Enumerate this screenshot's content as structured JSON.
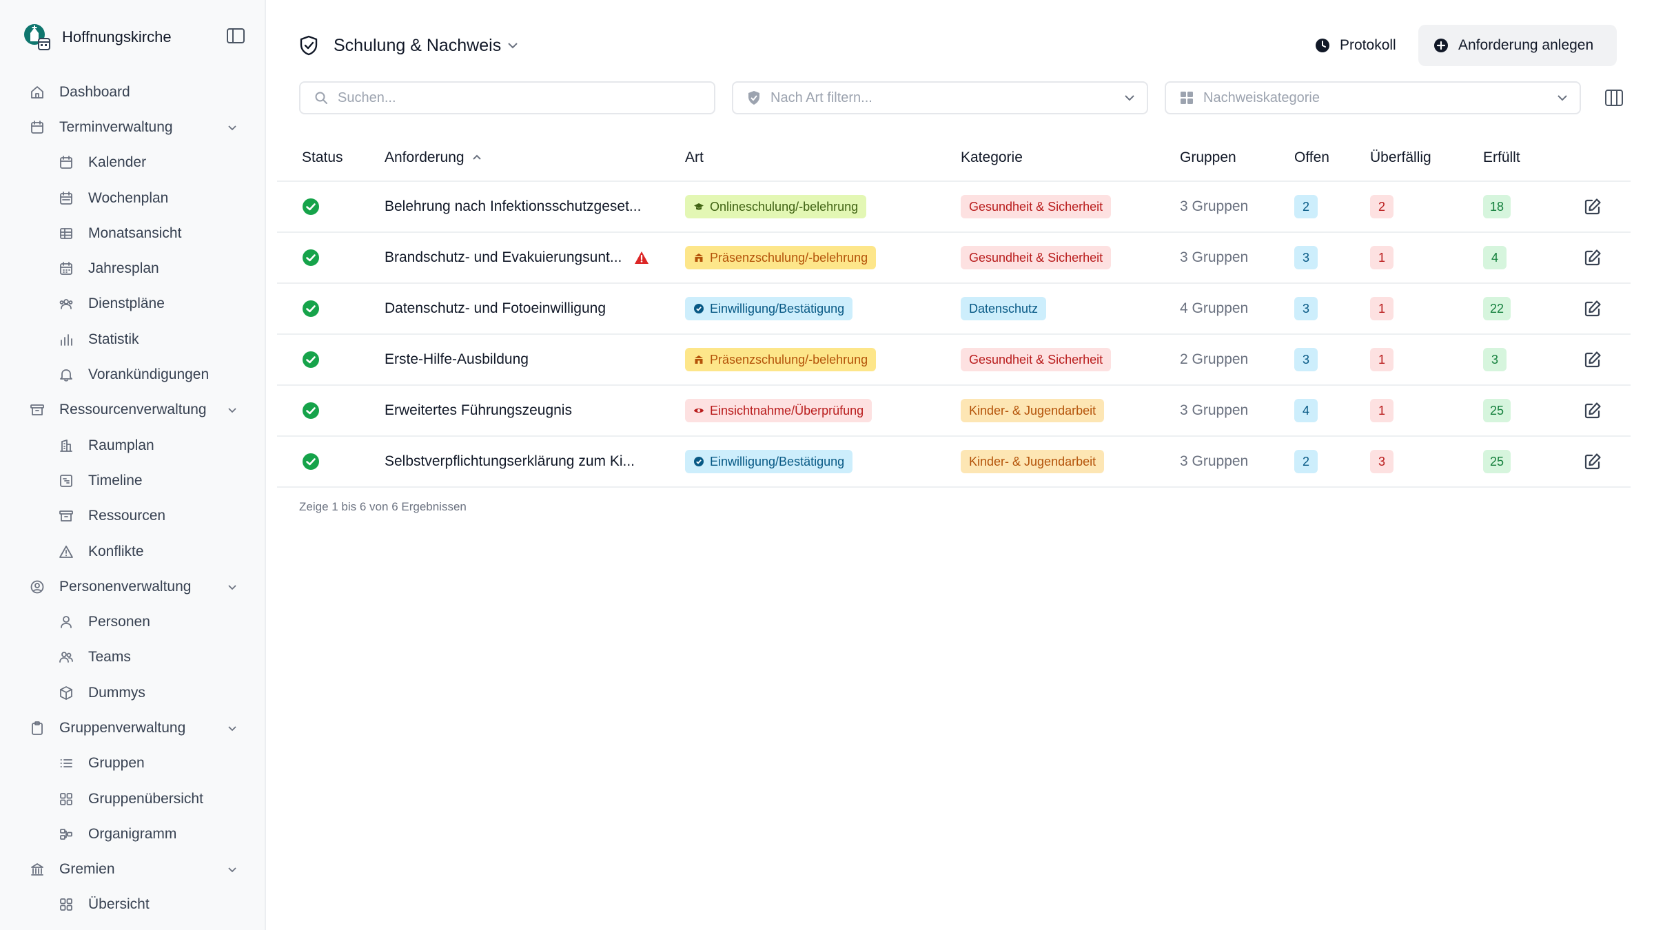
{
  "brand": {
    "name": "Hoffnungskirche"
  },
  "sidebar": {
    "items": [
      {
        "type": "top",
        "label": "Dashboard",
        "icon": "home-icon",
        "expandable": false
      },
      {
        "type": "top",
        "label": "Terminverwaltung",
        "icon": "calendar-icon",
        "expandable": true
      },
      {
        "type": "sub",
        "label": "Kalender",
        "icon": "calendar-icon"
      },
      {
        "type": "sub",
        "label": "Wochenplan",
        "icon": "calendar-week-icon"
      },
      {
        "type": "sub",
        "label": "Monatsansicht",
        "icon": "table-icon"
      },
      {
        "type": "sub",
        "label": "Jahresplan",
        "icon": "calendar-days-icon"
      },
      {
        "type": "sub",
        "label": "Dienstpläne",
        "icon": "users-cog-icon"
      },
      {
        "type": "sub",
        "label": "Statistik",
        "icon": "bar-chart-icon"
      },
      {
        "type": "sub",
        "label": "Vorankündigungen",
        "icon": "bell-icon"
      },
      {
        "type": "top",
        "label": "Ressourcenverwaltung",
        "icon": "archive-icon",
        "expandable": true
      },
      {
        "type": "sub",
        "label": "Raumplan",
        "icon": "building-icon"
      },
      {
        "type": "sub",
        "label": "Timeline",
        "icon": "chart-gantt-icon"
      },
      {
        "type": "sub",
        "label": "Ressourcen",
        "icon": "archive-icon"
      },
      {
        "type": "sub",
        "label": "Konflikte",
        "icon": "warning-icon"
      },
      {
        "type": "top",
        "label": "Personenverwaltung",
        "icon": "user-circle-icon",
        "expandable": true
      },
      {
        "type": "sub",
        "label": "Personen",
        "icon": "user-icon"
      },
      {
        "type": "sub",
        "label": "Teams",
        "icon": "users-icon"
      },
      {
        "type": "sub",
        "label": "Dummys",
        "icon": "box-icon"
      },
      {
        "type": "top",
        "label": "Gruppenverwaltung",
        "icon": "clipboard-icon",
        "expandable": true
      },
      {
        "type": "sub",
        "label": "Gruppen",
        "icon": "list-icon"
      },
      {
        "type": "sub",
        "label": "Gruppenübersicht",
        "icon": "grid-icon"
      },
      {
        "type": "sub",
        "label": "Organigramm",
        "icon": "org-chart-icon"
      },
      {
        "type": "top",
        "label": "Gremien",
        "icon": "landmark-icon",
        "expandable": true
      },
      {
        "type": "sub",
        "label": "Übersicht",
        "icon": "grid-icon"
      }
    ]
  },
  "header": {
    "title": "Schulung & Nachweis",
    "protokoll_label": "Protokoll",
    "add_label": "Anforderung anlegen"
  },
  "filters": {
    "search_placeholder": "Suchen...",
    "art_placeholder": "Nach Art filtern...",
    "kategorie_placeholder": "Nachweiskategorie"
  },
  "table": {
    "columns": {
      "status": "Status",
      "anforderung": "Anforderung",
      "art": "Art",
      "kategorie": "Kategorie",
      "gruppen": "Gruppen",
      "offen": "Offen",
      "ueberfaellig": "Überfällig",
      "erfuellt": "Erfüllt"
    },
    "sort": {
      "column": "anforderung",
      "direction": "asc"
    },
    "rows": [
      {
        "name": "Belehrung nach Infektionsschutzgeset...",
        "warning": false,
        "art": "Onlineschulung/-belehrung",
        "art_kind": "online",
        "kategorie": "Gesundheit & Sicherheit",
        "kat_kind": "health",
        "gruppen": "3 Gruppen",
        "offen": "2",
        "ueberfaellig": "2",
        "erfuellt": "18"
      },
      {
        "name": "Brandschutz- und Evakuierungsunt...",
        "warning": true,
        "art": "Präsenzschulung/-belehrung",
        "art_kind": "praesenz",
        "kategorie": "Gesundheit & Sicherheit",
        "kat_kind": "health",
        "gruppen": "3 Gruppen",
        "offen": "3",
        "ueberfaellig": "1",
        "erfuellt": "4"
      },
      {
        "name": "Datenschutz- und Fotoeinwilligung",
        "warning": false,
        "art": "Einwilligung/Bestätigung",
        "art_kind": "consent",
        "kategorie": "Datenschutz",
        "kat_kind": "privacy",
        "gruppen": "4 Gruppen",
        "offen": "3",
        "ueberfaellig": "1",
        "erfuellt": "22"
      },
      {
        "name": "Erste-Hilfe-Ausbildung",
        "warning": false,
        "art": "Präsenzschulung/-belehrung",
        "art_kind": "praesenz",
        "kategorie": "Gesundheit & Sicherheit",
        "kat_kind": "health",
        "gruppen": "2 Gruppen",
        "offen": "3",
        "ueberfaellig": "1",
        "erfuellt": "3"
      },
      {
        "name": "Erweitertes Führungszeugnis",
        "warning": false,
        "art": "Einsichtnahme/Überprüfung",
        "art_kind": "inspect",
        "kategorie": "Kinder- & Jugendarbeit",
        "kat_kind": "youth",
        "gruppen": "3 Gruppen",
        "offen": "4",
        "ueberfaellig": "1",
        "erfuellt": "25"
      },
      {
        "name": "Selbstverpflichtungserklärung zum Ki...",
        "warning": false,
        "art": "Einwilligung/Bestätigung",
        "art_kind": "consent",
        "kategorie": "Kinder- & Jugendarbeit",
        "kat_kind": "youth",
        "gruppen": "3 Gruppen",
        "offen": "2",
        "ueberfaellig": "3",
        "erfuellt": "25"
      }
    ]
  },
  "footer": {
    "result_text": "Zeige 1 bis 6 von 6 Ergebnissen"
  },
  "colors": {
    "sidebar_bg": "#f8f9fa",
    "status_ok": "#16a34a",
    "warning": "#dc2626",
    "online_bg": "#e3f7b4",
    "online_fg": "#3f6212",
    "praesenz_bg": "#fde68a",
    "praesenz_fg": "#b45309",
    "consent_bg": "#cdeefc",
    "consent_fg": "#075985",
    "inspect_bg": "#fde1e1",
    "inspect_fg": "#b91c1c",
    "health_bg": "#fde1e1",
    "health_fg": "#b91c1c",
    "privacy_bg": "#cdeefc",
    "privacy_fg": "#075985",
    "youth_bg": "#fde6b4",
    "youth_fg": "#b45309",
    "offen_bg": "#cdeefc",
    "offen_fg": "#075985",
    "ueberfaellig_bg": "#fde1e1",
    "ueberfaellig_fg": "#b91c1c",
    "erfuellt_bg": "#d6f5dd",
    "erfuellt_fg": "#15803d"
  }
}
